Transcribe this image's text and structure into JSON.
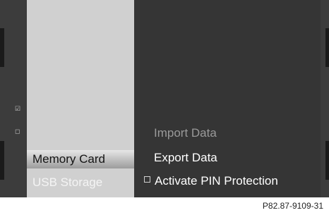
{
  "left_strip": {
    "icons": [
      "checked-box-icon",
      "square-icon"
    ]
  },
  "left_menu": {
    "items": [
      {
        "label": "Memory Card",
        "selected": true
      },
      {
        "label": "USB Storage",
        "selected": false
      }
    ]
  },
  "right_menu": {
    "items": [
      {
        "label": "Import Data",
        "state": "disabled"
      },
      {
        "label": "Export Data",
        "state": "highlighted"
      },
      {
        "label": "Activate PIN Protection",
        "state": "normal",
        "has_checkbox": true,
        "checked": false
      }
    ]
  },
  "caption": "P82.87-9109-31"
}
